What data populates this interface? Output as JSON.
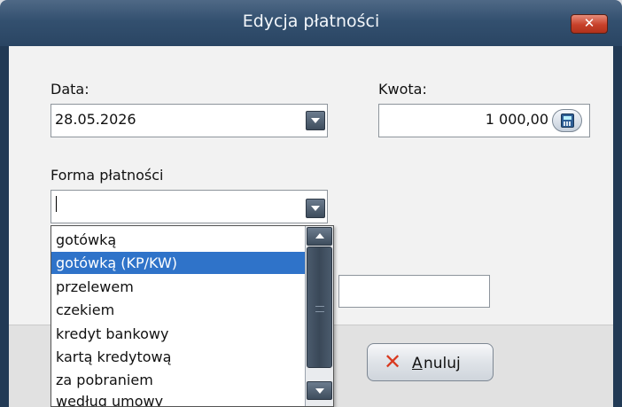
{
  "window": {
    "title": "Edycja płatności",
    "close_icon": "close-icon"
  },
  "form": {
    "date_label": "Data:",
    "date_value": "28.05.2026",
    "amount_label": "Kwota:",
    "amount_value": "1 000,00",
    "payment_label": "Forma płatności",
    "payment_value": ""
  },
  "dropdown_list": {
    "items": [
      {
        "label": "gotówką",
        "selected": false
      },
      {
        "label": "gotówką (KP/KW)",
        "selected": true
      },
      {
        "label": "przelewem",
        "selected": false
      },
      {
        "label": "czekiem",
        "selected": false
      },
      {
        "label": "kredyt bankowy",
        "selected": false
      },
      {
        "label": "kartą kredytową",
        "selected": false
      },
      {
        "label": "za pobraniem",
        "selected": false
      },
      {
        "label": "według umowy",
        "selected": false
      }
    ]
  },
  "buttons": {
    "cancel_mnemonic": "A",
    "cancel_rest": "nuluj"
  },
  "colors": {
    "titlebar": "#33506f",
    "selection": "#2f73c9",
    "cancel_icon": "#d9391f"
  }
}
